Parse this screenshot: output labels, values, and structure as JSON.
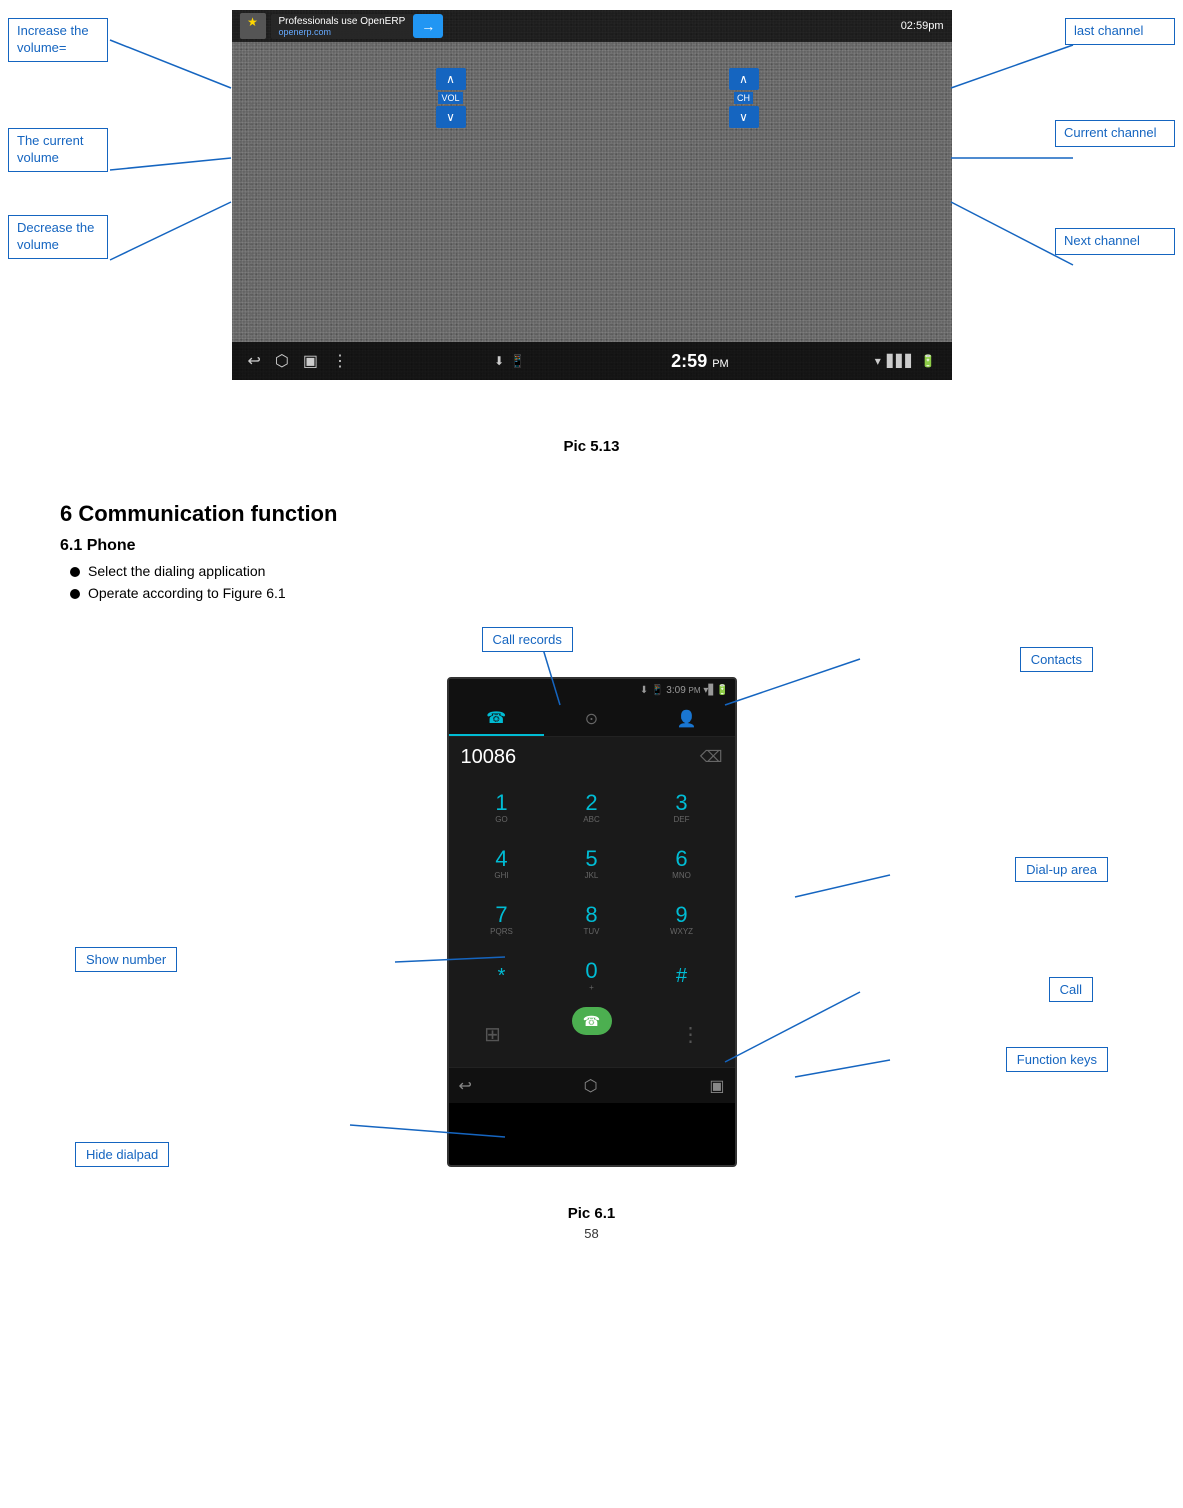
{
  "tv_section": {
    "annotations": {
      "increase_volume": "Increase the volume=",
      "current_volume": "The current volume",
      "decrease_volume": "Decrease the volume",
      "last_channel": "last channel",
      "current_channel": "Current channel",
      "next_channel": "Next channel"
    },
    "vol_up_label": "∧",
    "vol_label": "VOL",
    "vol_down_label": "∨",
    "ch_up_label": "∧",
    "ch_label": "CH",
    "ch_down_label": "∨",
    "caption": "Pic 5.13",
    "tv_topbar": {
      "title": "Professionals use OpenERP",
      "link": "openerp.com",
      "time": "02:59pm"
    },
    "tv_bottombar": {
      "time": "2:59",
      "time_pm": "PM"
    }
  },
  "section6": {
    "title": "6 Communication function",
    "subsection": "6.1 Phone",
    "bullets": [
      "Select the dialing application",
      "Operate according to Figure 6.1"
    ],
    "phone_diagram": {
      "annotations": {
        "call_records": "Call records",
        "contacts": "Contacts",
        "dial_up_area": "Dial-up area",
        "call": "Call",
        "function_keys": "Function keys",
        "show_number": "Show number",
        "hide_dialpad": "Hide dialpad"
      },
      "number_display": "10086",
      "keypad": [
        [
          "1",
          "GO",
          "2",
          "ABC",
          "3",
          "DEF"
        ],
        [
          "4",
          "GHI",
          "5",
          "JKL",
          "6",
          "MNO"
        ],
        [
          "7",
          "PQRS",
          "8",
          "TUV",
          "9",
          "WXYZ"
        ],
        [
          "*",
          "",
          "0",
          "+",
          "#",
          ""
        ]
      ],
      "tabs": [
        "phone",
        "clock",
        "person"
      ],
      "caption": "Pic 6.1",
      "time": "3:09",
      "time_pm": "PM"
    }
  },
  "page_number": "58"
}
